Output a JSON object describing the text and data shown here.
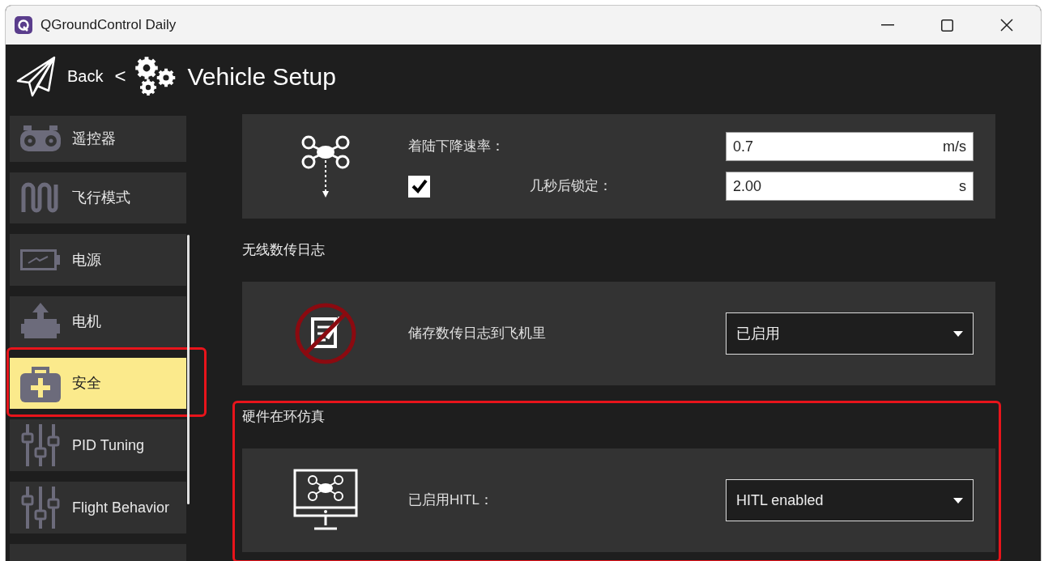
{
  "window": {
    "title": "QGroundControl Daily"
  },
  "header": {
    "back": "Back",
    "separator": "<",
    "title": "Vehicle Setup"
  },
  "sidebar": {
    "items": [
      {
        "kind": "remote",
        "label": "遥控器",
        "selected": false,
        "annotated": false
      },
      {
        "kind": "wave",
        "label": "飞行模式",
        "selected": false,
        "annotated": false
      },
      {
        "kind": "battery",
        "label": "电源",
        "selected": false,
        "annotated": false
      },
      {
        "kind": "motor",
        "label": "电机",
        "selected": false,
        "annotated": false
      },
      {
        "kind": "safety",
        "label": "安全",
        "selected": true,
        "annotated": true
      },
      {
        "kind": "sliders",
        "label": "PID Tuning",
        "selected": false,
        "annotated": false
      },
      {
        "kind": "sliders",
        "label": "Flight Behavior",
        "selected": false,
        "annotated": false
      },
      {
        "kind": "blank",
        "selected": false,
        "annotated": false
      }
    ]
  },
  "landing_card": {
    "descent_rate": {
      "label": "着陆下降速率：",
      "value": "0.7",
      "unit": "m/s"
    },
    "disarm": {
      "checked": true,
      "label": "几秒后锁定：",
      "value": "2.00",
      "unit": "s"
    }
  },
  "sections": [
    {
      "title": "无线数传日志",
      "annotated": false,
      "kind": "no-log",
      "label": "储存数传日志到飞机里",
      "dropdown": "已启用"
    },
    {
      "title": "硬件在环仿真",
      "annotated": true,
      "kind": "hitl",
      "label": "已启用HITL：",
      "dropdown": "HITL enabled"
    }
  ]
}
